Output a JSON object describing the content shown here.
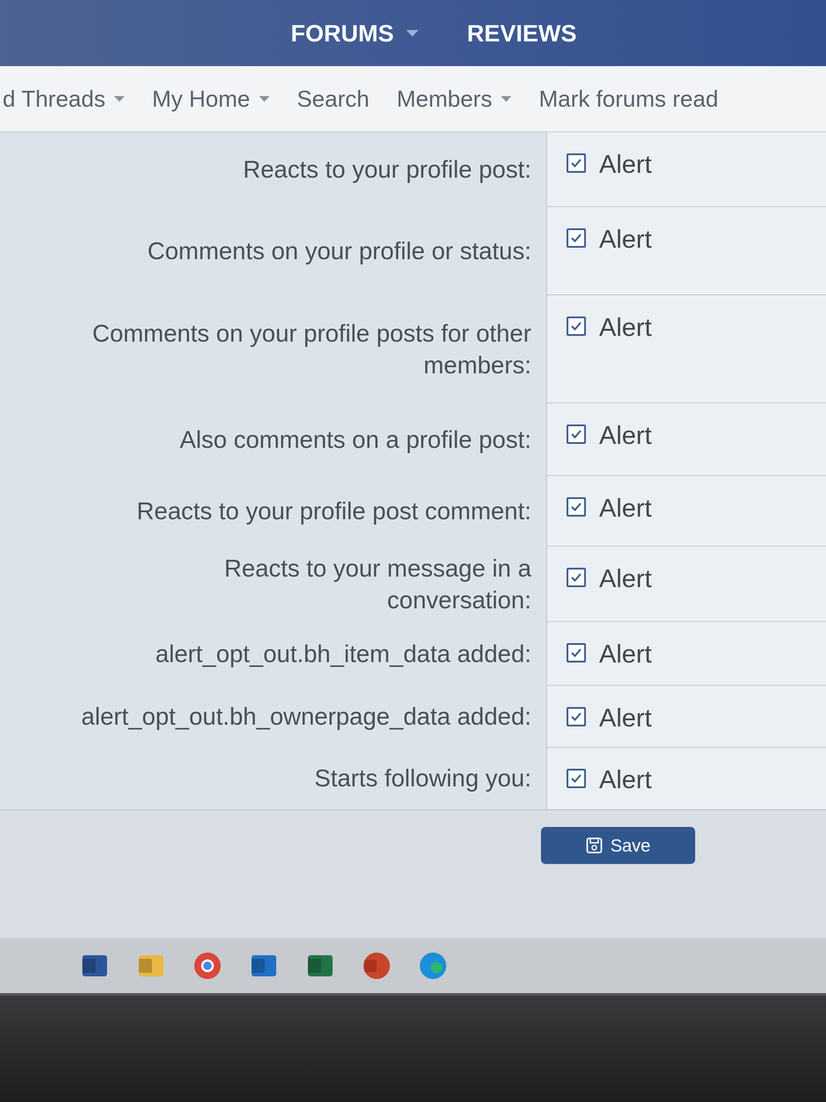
{
  "top_nav": [
    {
      "label": "FORUMS",
      "has_menu": true
    },
    {
      "label": "REVIEWS",
      "has_menu": false
    }
  ],
  "sub_nav": [
    {
      "label": "d Threads",
      "has_menu": true
    },
    {
      "label": "My Home",
      "has_menu": true
    },
    {
      "label": "Search",
      "has_menu": false
    },
    {
      "label": "Members",
      "has_menu": true
    },
    {
      "label": "Mark forums read",
      "has_menu": false
    }
  ],
  "preferences": [
    {
      "label": "Reacts to your profile post:",
      "option": "Alert",
      "checked": true
    },
    {
      "label": "Comments on your profile or status:",
      "option": "Alert",
      "checked": true
    },
    {
      "label": "Comments on your profile posts for other members:",
      "option": "Alert",
      "checked": true
    },
    {
      "label": "Also comments on a profile post:",
      "option": "Alert",
      "checked": true
    },
    {
      "label": "Reacts to your profile post comment:",
      "option": "Alert",
      "checked": true
    },
    {
      "label": "Reacts to your message in a conversation:",
      "option": "Alert",
      "checked": true
    },
    {
      "label": "alert_opt_out.bh_item_data added:",
      "option": "Alert",
      "checked": true
    },
    {
      "label": "alert_opt_out.bh_ownerpage_data added:",
      "option": "Alert",
      "checked": true
    },
    {
      "label": "Starts following you:",
      "option": "Alert",
      "checked": true
    }
  ],
  "save_button": "Save",
  "taskbar": [
    {
      "kind": "word",
      "color": "#2b579a"
    },
    {
      "kind": "explorer",
      "color": "#e8b840"
    },
    {
      "kind": "chrome",
      "color": "#d9463b"
    },
    {
      "kind": "outlook",
      "color": "#1f6fc5"
    },
    {
      "kind": "excel",
      "color": "#217346"
    },
    {
      "kind": "powerpoint",
      "color": "#c8452b"
    },
    {
      "kind": "edge",
      "color": "#1c8fd8"
    }
  ]
}
